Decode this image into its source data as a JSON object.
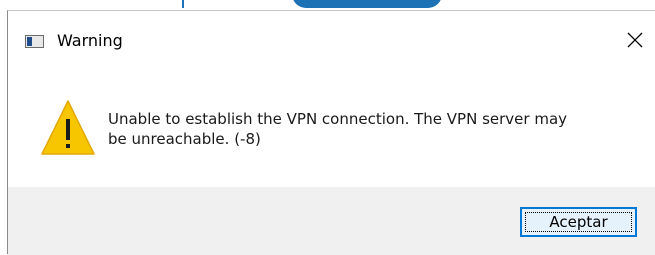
{
  "dialog": {
    "title": "Warning",
    "icons": {
      "app": "window-app-icon",
      "close": "close-icon",
      "status": "warning-icon"
    },
    "message_line1": "Unable to establish the VPN connection. The VPN server may",
    "message_line2": "be unreachable. (-8)",
    "ok_button_label": "Aceptar"
  },
  "colors": {
    "warning_yellow": "#f7c600",
    "focus_blue": "#0078d7",
    "footer_gray": "#f0f0f0"
  }
}
